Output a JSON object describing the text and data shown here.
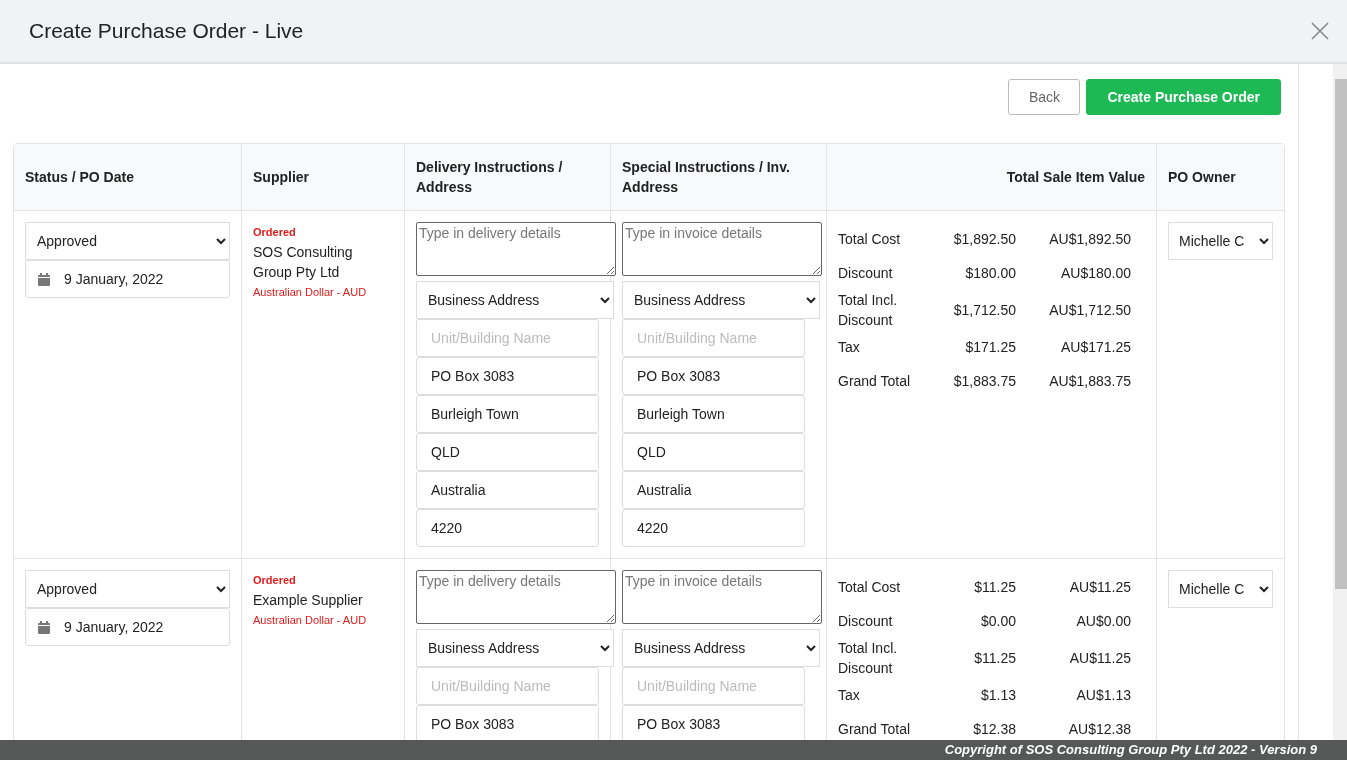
{
  "dialog": {
    "title": "Create Purchase Order - Live"
  },
  "buttons": [
    {
      "label": "Back",
      "kind": "secondary"
    },
    {
      "label": "Create Purchase Order",
      "kind": "primary"
    }
  ],
  "table": {
    "columns": [
      "Status / PO Date",
      "Supplier",
      "Delivery Instructions / Address",
      "Special Instructions / Inv. Address",
      "Total Sale Item Value",
      "PO Owner"
    ],
    "rows": [
      {
        "status": "Approved",
        "date": "9 January, 2022",
        "order_state": "Ordered",
        "supplier": "SOS Consulting Group Pty Ltd",
        "currency": "Australian Dollar - AUD",
        "delivery": {
          "placeholder": "Type in delivery details",
          "address_type": "Business Address",
          "fields": [
            {
              "placeholder": "Unit/Building Name"
            },
            {
              "value": "PO Box 3083"
            },
            {
              "value": "Burleigh Town"
            },
            {
              "value": "QLD"
            },
            {
              "value": "Australia"
            },
            {
              "value": "4220"
            }
          ]
        },
        "invoice": {
          "placeholder": "Type in invoice details",
          "address_type": "Business Address",
          "fields": [
            {
              "placeholder": "Unit/Building Name"
            },
            {
              "value": "PO Box 3083"
            },
            {
              "value": "Burleigh Town"
            },
            {
              "value": "QLD"
            },
            {
              "value": "Australia"
            },
            {
              "value": "4220"
            }
          ]
        },
        "totals": [
          {
            "label": "Total Cost",
            "amount": "$1,892.50",
            "amount_aud": "AU$1,892.50"
          },
          {
            "label": "Discount",
            "amount": "$180.00",
            "amount_aud": "AU$180.00"
          },
          {
            "label": "Total Incl. Discount",
            "amount": "$1,712.50",
            "amount_aud": "AU$1,712.50"
          },
          {
            "label": "Tax",
            "amount": "$171.25",
            "amount_aud": "AU$171.25"
          },
          {
            "label": "Grand Total",
            "amount": "$1,883.75",
            "amount_aud": "AU$1,883.75"
          }
        ],
        "owner": "Michelle C"
      },
      {
        "status": "Approved",
        "date": "9 January, 2022",
        "order_state": "Ordered",
        "supplier": "Example Supplier",
        "currency": "Australian Dollar - AUD",
        "delivery": {
          "placeholder": "Type in delivery details",
          "address_type": "Business Address",
          "fields": [
            {
              "placeholder": "Unit/Building Name"
            },
            {
              "value": "PO Box 3083"
            }
          ]
        },
        "invoice": {
          "placeholder": "Type in invoice details",
          "address_type": "Business Address",
          "fields": [
            {
              "placeholder": "Unit/Building Name"
            },
            {
              "value": "PO Box 3083"
            }
          ]
        },
        "totals": [
          {
            "label": "Total Cost",
            "amount": "$11.25",
            "amount_aud": "AU$11.25"
          },
          {
            "label": "Discount",
            "amount": "$0.00",
            "amount_aud": "AU$0.00"
          },
          {
            "label": "Total Incl. Discount",
            "amount": "$11.25",
            "amount_aud": "AU$11.25"
          },
          {
            "label": "Tax",
            "amount": "$1.13",
            "amount_aud": "AU$1.13"
          },
          {
            "label": "Grand Total",
            "amount": "$12.38",
            "amount_aud": "AU$12.38"
          }
        ],
        "owner": "Michelle C"
      }
    ]
  },
  "footer": "Copyright of SOS Consulting Group Pty Ltd 2022 - Version 9"
}
